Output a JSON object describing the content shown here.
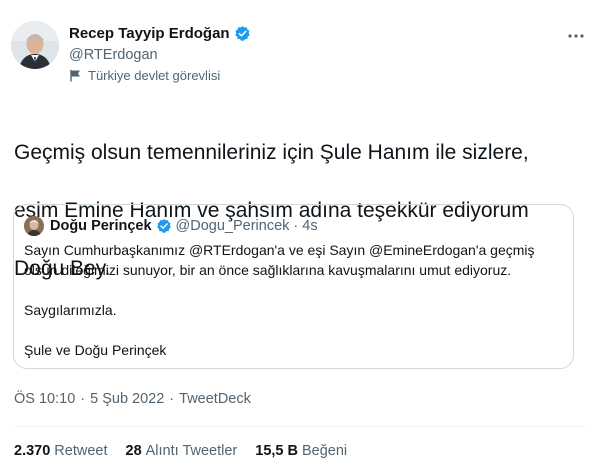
{
  "author": {
    "name": "Recep Tayyip Erdoğan",
    "handle": "@RTErdogan",
    "label": "Türkiye devlet görevlisi",
    "verified": true
  },
  "tweet": {
    "text_line1": "Geçmiş olsun temennileriniz için Şule Hanım ile sizlere,",
    "text_line2": "eşim Emine Hanım ve şahsım adına teşekkür ediyorum",
    "text_line3": "Doğu Bey."
  },
  "quoted_tweet": {
    "name": "Doğu Perinçek",
    "handle": "@Dogu_Perincek",
    "separator": "·",
    "time": "4s",
    "line1": "Sayın Cumhurbaşkanımız @RTErdogan'a ve eşi Sayın @EmineErdogan'a geçmiş",
    "line2": "olsun dileğimizi sunuyor, bir an önce sağlıklarına kavuşmalarını umut ediyoruz.",
    "line3": "Saygılarımızla.",
    "line4": "Şule ve Doğu Perinçek"
  },
  "meta": {
    "time": "ÖS 10:10",
    "separator": "·",
    "date": "5 Şub 2022",
    "source": "TweetDeck"
  },
  "stats": {
    "retweets_count": "2.370",
    "retweets_label": "Retweet",
    "quotes_count": "28",
    "quotes_label": "Alıntı Tweetler",
    "likes_count": "15,5 B",
    "likes_label": "Beğeni"
  },
  "colors": {
    "verified_blue": "#1d9bf0",
    "text_primary": "#0f1419",
    "text_secondary": "#536471",
    "border": "#cfd9de"
  },
  "icons": {
    "verified": "verified-badge-icon",
    "label": "flag-icon",
    "more": "more-options-icon"
  }
}
